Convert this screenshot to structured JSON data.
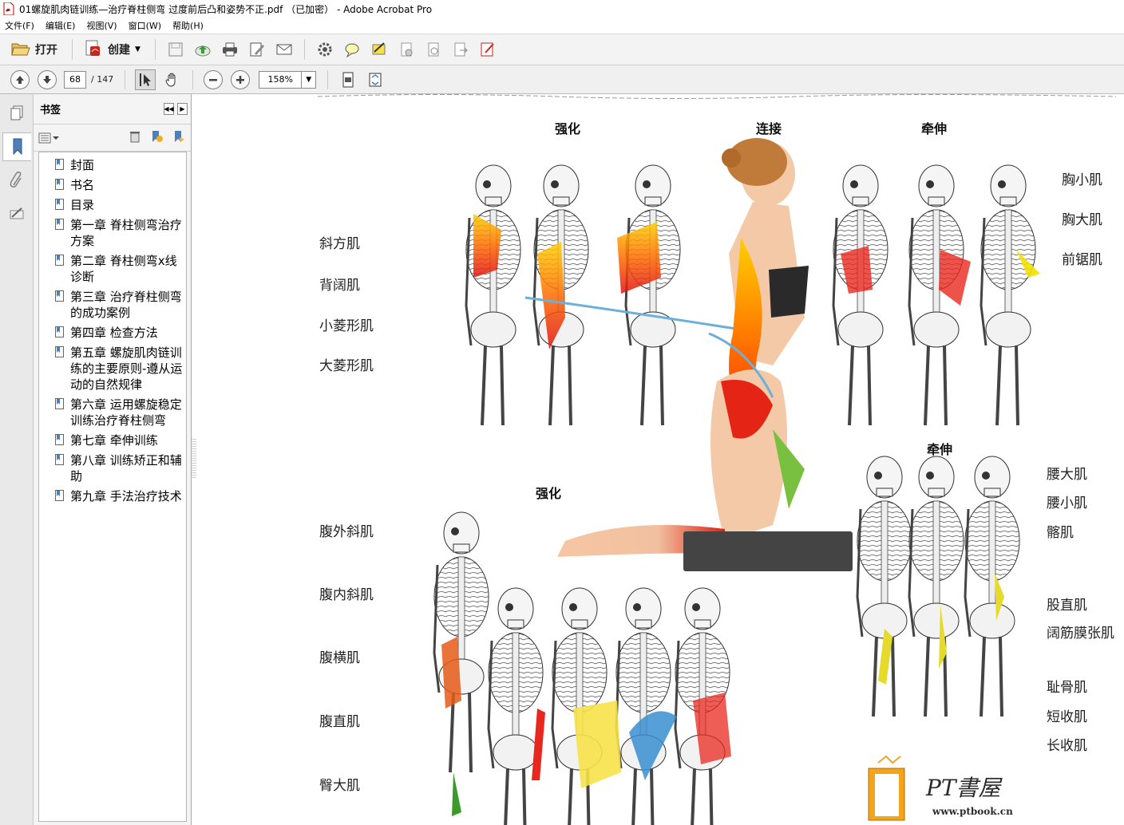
{
  "window": {
    "title": "01螺旋肌肉链训练—治疗脊柱侧弯 过度前后凸和姿势不正.pdf （已加密） - Adobe Acrobat Pro"
  },
  "menu": [
    "文件(F)",
    "编辑(E)",
    "视图(V)",
    "窗口(W)",
    "帮助(H)"
  ],
  "toolbar": {
    "open_label": "打开",
    "create_label": "创建",
    "icons": [
      "save-icon",
      "upload-icon",
      "print-icon",
      "edit-icon",
      "email-icon",
      "gear-icon",
      "comment-icon",
      "sign-icon",
      "secure-icon",
      "review-icon",
      "export-icon",
      "form-icon"
    ]
  },
  "navigation": {
    "current_page": "68",
    "total_pages": "/ 147",
    "zoom": "158%"
  },
  "bookmarks": {
    "title": "书签",
    "items": [
      {
        "label": "封面"
      },
      {
        "label": "书名"
      },
      {
        "label": "目录"
      },
      {
        "label": "第一章 脊柱侧弯治疗方案"
      },
      {
        "label": "第二章 脊柱侧弯x线诊断"
      },
      {
        "label": "第三章 治疗脊柱侧弯的成功案例"
      },
      {
        "label": "第四章 检查方法"
      },
      {
        "label": "第五章 螺旋肌肉链训练的主要原则-遵从运动的自然规律"
      },
      {
        "label": "第六章 运用螺旋稳定训练治疗脊柱侧弯"
      },
      {
        "label": "第七章 牵伸训练"
      },
      {
        "label": "第八章 训练矫正和辅助"
      },
      {
        "label": "第九章 手法治疗技术"
      }
    ]
  },
  "document": {
    "headers": {
      "strengthen_top": "强化",
      "connect": "连接",
      "stretch_top": "牵伸",
      "strengthen_bottom": "强化",
      "stretch_bottom": "牵伸"
    },
    "left_labels_top": [
      "斜方肌",
      "背阔肌",
      "小菱形肌",
      "大菱形肌"
    ],
    "left_labels_bottom": [
      "腹外斜肌",
      "腹内斜肌",
      "腹横肌",
      "腹直肌",
      "臀大肌"
    ],
    "right_labels_top": [
      "胸小肌",
      "胸大肌",
      "前锯肌"
    ],
    "right_labels_bottom": [
      "腰大肌",
      "腰小肌",
      "髂肌",
      "股直肌",
      "阔筋膜张肌",
      "耻骨肌",
      "短收肌",
      "长收肌"
    ],
    "watermark": {
      "title": "PT書屋",
      "url": "www.ptbook.cn"
    }
  }
}
